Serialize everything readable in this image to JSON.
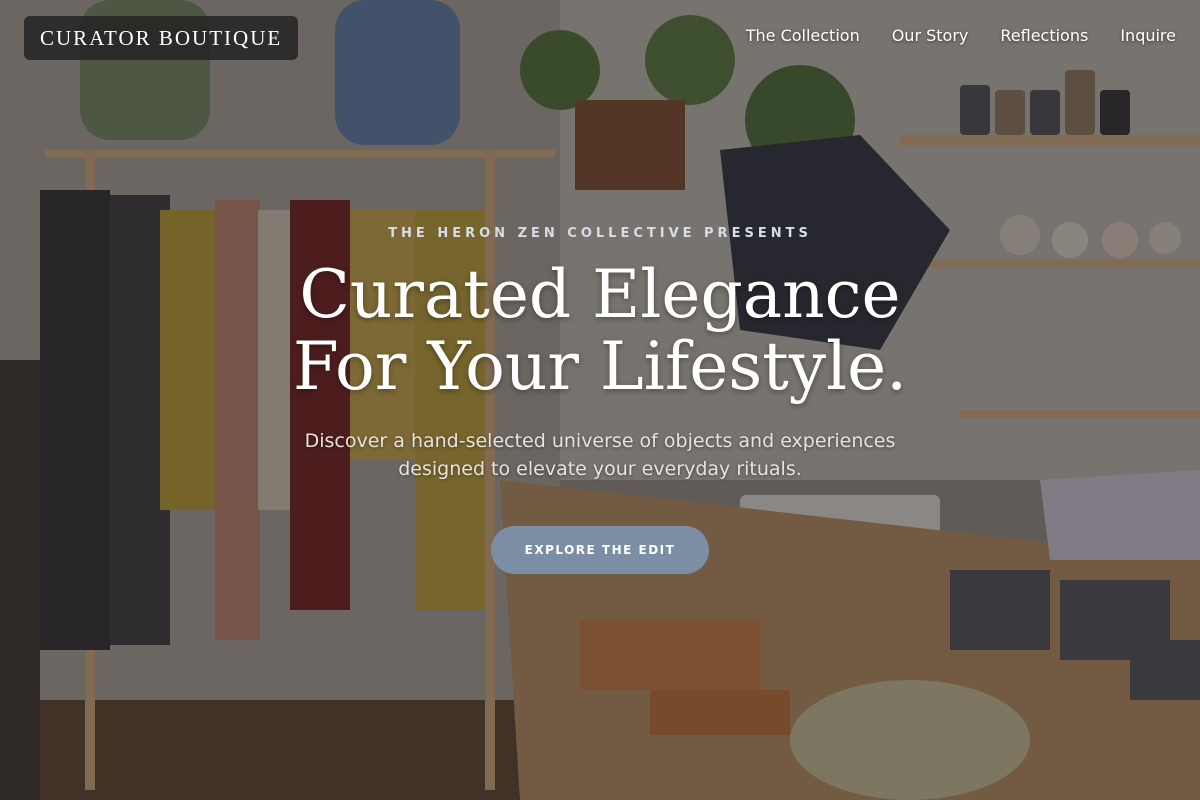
{
  "brand": {
    "logo_text": "CURATOR BOUTIQUE"
  },
  "nav": {
    "items": [
      {
        "label": "The Collection"
      },
      {
        "label": "Our Story"
      },
      {
        "label": "Reflections"
      },
      {
        "label": "Inquire"
      }
    ]
  },
  "hero": {
    "eyebrow": "THE HERON ZEN COLLECTIVE PRESENTS",
    "headline_line1": "Curated Elegance",
    "headline_line2": "For Your Lifestyle.",
    "subtitle": "Discover a hand-selected universe of objects and experiences designed to elevate your everyday rituals.",
    "cta_label": "EXPLORE THE EDIT"
  },
  "colors": {
    "cta_background": "#7b8ea3",
    "logo_background": "#262626",
    "text": "#ffffff"
  }
}
